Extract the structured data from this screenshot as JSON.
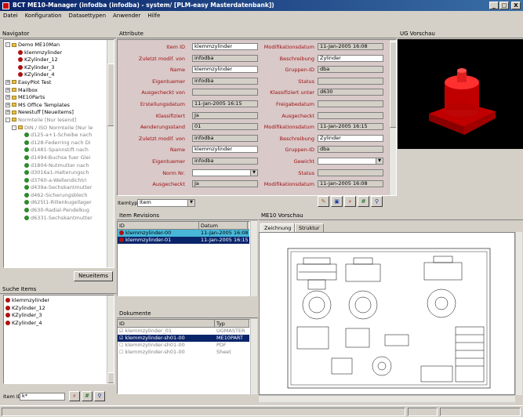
{
  "window": {
    "title": "BCT ME10-Manager (infodba (infodba) - system/ [PLM-easy Masterdatenbank])",
    "min": "_",
    "max": "□",
    "close": "X"
  },
  "menu": [
    "Datei",
    "Konfiguration",
    "Datasettypen",
    "Anwender",
    "Hilfe"
  ],
  "navigator": {
    "title": "Navigator",
    "tree": [
      {
        "label": "Demo ME10Man",
        "icon": "folder",
        "level": 1,
        "pm": "-"
      },
      {
        "label": "klemmzylinder",
        "icon": "red",
        "level": 2
      },
      {
        "label": "KZylinder_12",
        "icon": "red",
        "level": 2
      },
      {
        "label": "KZylinder_3",
        "icon": "red",
        "level": 2
      },
      {
        "label": "KZylinder_4",
        "icon": "red",
        "level": 2
      },
      {
        "label": "EasyPlot Test",
        "icon": "folder",
        "level": 1,
        "pm": "+"
      },
      {
        "label": "Mailbox",
        "icon": "folder",
        "level": 1,
        "pm": "+"
      },
      {
        "label": "ME10Parts",
        "icon": "folder",
        "level": 1,
        "pm": "+"
      },
      {
        "label": "MS Office Templates",
        "icon": "folder",
        "level": 1,
        "pm": "+"
      },
      {
        "label": "Newstuff [Neueitems]",
        "icon": "folder",
        "level": 1,
        "pm": "+"
      },
      {
        "label": "Normteile [Nur lesend]",
        "icon": "folder",
        "level": 1,
        "pm": "-",
        "gray": true
      },
      {
        "label": "DIN / ISO Normteile [Nur le",
        "icon": "folder",
        "level": 2,
        "pm": "-",
        "gray": true
      },
      {
        "label": "d125-a+1-Scheibe nach",
        "icon": "green",
        "level": 3,
        "gray": true
      },
      {
        "label": "d128-Federring nach Di",
        "icon": "green",
        "level": 3,
        "gray": true
      },
      {
        "label": "d1481-Spannstift nach",
        "icon": "green",
        "level": 3,
        "gray": true
      },
      {
        "label": "d1494-Buchse fuer Glei",
        "icon": "green",
        "level": 3,
        "gray": true
      },
      {
        "label": "d1804-Nutmutter nach",
        "icon": "green",
        "level": 3,
        "gray": true
      },
      {
        "label": "d3016a1-Halterungsch",
        "icon": "green",
        "level": 3,
        "gray": true
      },
      {
        "label": "d3760-a-Wellendichtri",
        "icon": "green",
        "level": 3,
        "gray": true
      },
      {
        "label": "d439a-Sechskantmutter",
        "icon": "green",
        "level": 3,
        "gray": true
      },
      {
        "label": "d462-Sicherungsblech",
        "icon": "green",
        "level": 3,
        "gray": true
      },
      {
        "label": "d625t1-Rillenkugellager",
        "icon": "green",
        "level": 3,
        "gray": true
      },
      {
        "label": "d630-Radial-Pendelkug",
        "icon": "green",
        "level": 3,
        "gray": true
      },
      {
        "label": "d6331-Sechskantmutter",
        "icon": "green",
        "level": 3,
        "gray": true
      }
    ],
    "refresh_button": "Neueitems"
  },
  "search": {
    "title": "Suche Items",
    "results": [
      "klemmzylinder",
      "KZylinder_12",
      "KZylinder_3",
      "KZylinder_4"
    ],
    "item_id_label": "Item ID",
    "item_id_value": "k*"
  },
  "attributes": {
    "title": "Attribute",
    "rows": [
      {
        "l1": "Item ID",
        "v1": "klemmzylinder",
        "l2": "Modifikationsdatum",
        "v2": "11-Jan-2005 16:08",
        "w1": true
      },
      {
        "l1": "Zuletzt modif. von",
        "v1": "infodba",
        "l2": "Beschreibung",
        "v2": "Zylinder",
        "w2": true
      },
      {
        "l1": "Name",
        "v1": "klemmzylinder",
        "l2": "Gruppen-ID",
        "v2": "dba",
        "w1": true
      },
      {
        "l1": "Eigentuemer",
        "v1": "infodba",
        "l2": "Status",
        "v2": ""
      },
      {
        "l1": "Ausgecheckt von",
        "v1": "",
        "l2": "Klassifiziert unter",
        "v2": "d630"
      },
      {
        "l1": "Erstellungsdatum",
        "v1": "11-Jan-2005 16:15",
        "l2": "Freigabedatum",
        "v2": ""
      },
      {
        "l1": "Klassifiziert",
        "v1": "Ja",
        "l2": "Ausgecheckt",
        "v2": ""
      },
      {
        "l1": "Aenderungsstand",
        "v1": "01",
        "l2": "Modifikationsdatum",
        "v2": "11-Jan-2005 16:15"
      },
      {
        "l1": "Zuletzt modif. von",
        "v1": "infodba",
        "l2": "Beschreibung",
        "v2": "Zylinder",
        "w2": true
      },
      {
        "l1": "Name",
        "v1": "klemmzylinder",
        "l2": "Gruppen-ID",
        "v2": "dba",
        "w1": true
      },
      {
        "l1": "Eigentuemer",
        "v1": "infodba",
        "l2": "Gewicht",
        "v2": "",
        "w2": true,
        "dd2": true
      },
      {
        "l1": "Norm Nr.",
        "v1": "",
        "l2": "Status",
        "v2": "",
        "w1": true,
        "dd1": true
      },
      {
        "l1": "Ausgecheckt",
        "v1": "Ja",
        "l2": "Modifikationsdatum",
        "v2": "11-Jan-2005 16:08"
      }
    ],
    "itemtyp_label": "Itemtyp",
    "itemtyp_value": "Item"
  },
  "ug_preview": {
    "title": "UG Vorschau"
  },
  "revisions": {
    "title": "Item Revisions",
    "col_id": "ID",
    "col_date": "Datum",
    "rows": [
      {
        "id": "klemmzylinder-00",
        "date": "11-Jan-2005 16:08"
      },
      {
        "id": "klemmzylinder-01",
        "date": "11-Jan-2005 16:15"
      }
    ]
  },
  "documents": {
    "title": "Dokumente",
    "col_id": "ID",
    "col_type": "Typ",
    "rows": [
      {
        "id": "klemmzylinder_01",
        "type": "UGMASTER"
      },
      {
        "id": "klemmzylinder-sh01-00",
        "type": "ME10PART"
      },
      {
        "id": "klemmzylinder-sh01-00",
        "type": "PDF"
      },
      {
        "id": "klemmzylinder-sh01-00",
        "type": "Sheet"
      }
    ]
  },
  "me10_preview": {
    "title": "ME10 Vorschau",
    "tabs": [
      "Zeichnung",
      "Struktur"
    ]
  }
}
